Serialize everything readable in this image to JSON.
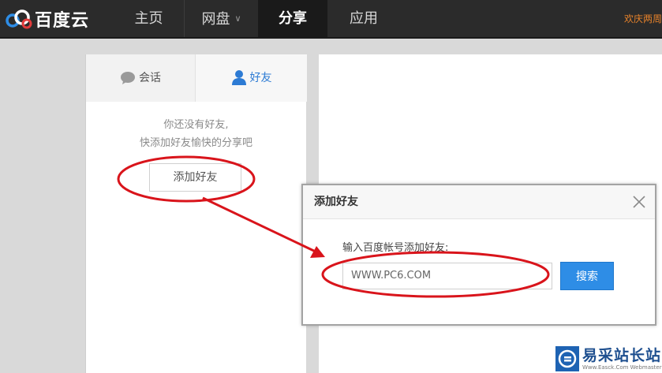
{
  "header": {
    "logo_text": "百度云",
    "nav": [
      {
        "label": "主页"
      },
      {
        "label": "网盘"
      },
      {
        "label": "分享"
      },
      {
        "label": "应用"
      }
    ],
    "active_nav": "分享",
    "welcome_text": "欢庆两周"
  },
  "sidebar": {
    "tabs": [
      {
        "label": "会话"
      },
      {
        "label": "好友"
      }
    ],
    "active_tab": "好友",
    "empty_line1": "你还没有好友,",
    "empty_line2": "快添加好友愉快的分享吧",
    "add_button": "添加好友"
  },
  "dialog": {
    "title": "添加好友",
    "label": "输入百度帐号添加好友:",
    "input_value": "WWW.PC6.COM",
    "search_button": "搜索"
  },
  "watermark": {
    "main": "易采站长站",
    "sub": "Www.Easck.Com Webmaster"
  },
  "colors": {
    "topbar": "#2b2b2b",
    "accent_blue": "#2d7bd4",
    "annotation_red": "#d9141b",
    "welcome_orange": "#e6822b"
  }
}
